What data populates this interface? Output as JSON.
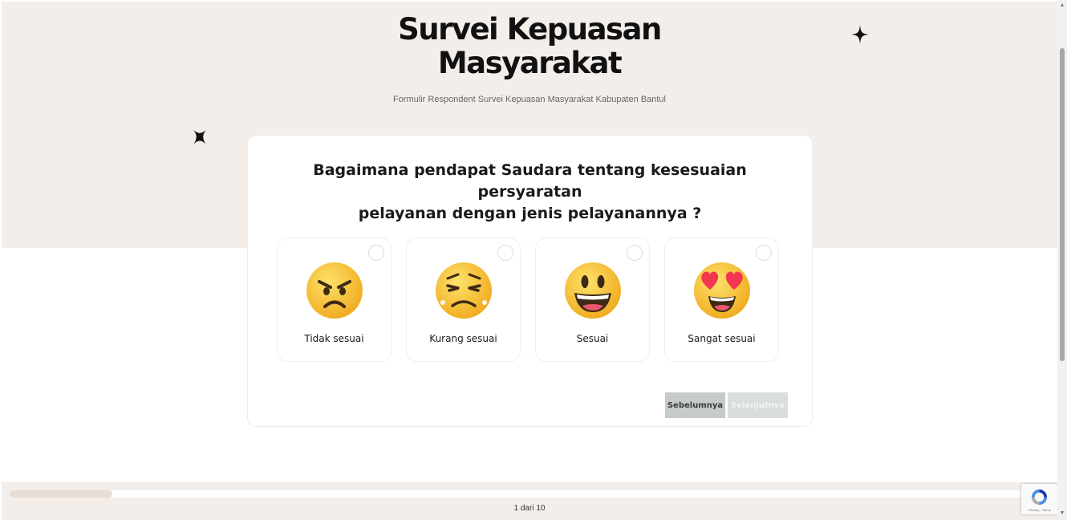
{
  "header": {
    "title_line1": "Survei Kepuasan",
    "title_line2": "Masyarakat",
    "subtitle": "Formulir Respondent Survei Kepuasan Masyarakat Kabupaten Bantul"
  },
  "question": {
    "line1": "Bagaimana pendapat Saudara tentang kesesuaian persyaratan",
    "line2": "pelayanan dengan jenis pelayanannya ?"
  },
  "options": [
    {
      "label": "Tidak sesuai",
      "icon": "angry-face-icon",
      "selected": false
    },
    {
      "label": "Kurang sesuai",
      "icon": "persevering-face-icon",
      "selected": false
    },
    {
      "label": "Sesuai",
      "icon": "grinning-face-icon",
      "selected": false
    },
    {
      "label": "Sangat sesuai",
      "icon": "heart-eyes-face-icon",
      "selected": false
    }
  ],
  "navigation": {
    "prev_label": "Sebelumnya",
    "next_label": "Selanjutnya",
    "next_disabled": true
  },
  "progress": {
    "current": 1,
    "total": 10,
    "text": "1 dari 10"
  },
  "recaptcha": {
    "text": "Privacy - Terms"
  },
  "colors": {
    "hero_background": "#f4eeea",
    "card_background": "#ffffff",
    "button_prev": "#c5cbcb",
    "button_next_disabled": "#d9dddd",
    "emoji_yellow": "#f7c948"
  }
}
